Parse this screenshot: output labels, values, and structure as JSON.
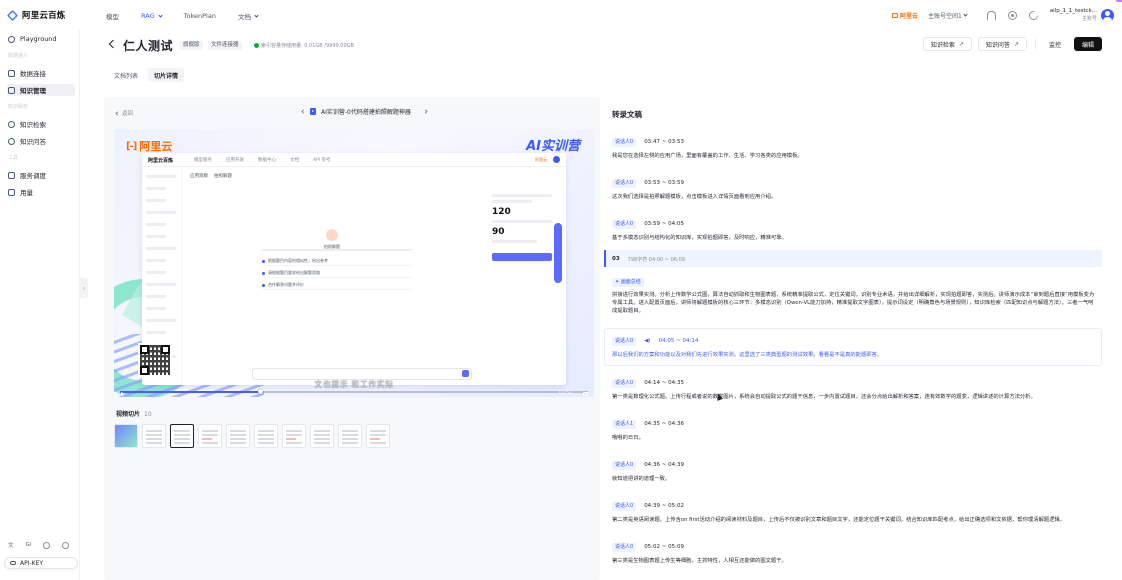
{
  "app": {
    "logo_text": "阿里云百炼",
    "nav": [
      {
        "label": "模型",
        "dropdown": false,
        "active": false
      },
      {
        "label": "RAG",
        "dropdown": true,
        "active": true
      },
      {
        "label": "TokenPlan",
        "dropdown": false,
        "active": false
      },
      {
        "label": "文档",
        "dropdown": true,
        "active": false
      }
    ],
    "brand_label": "阿里云",
    "workspace_label": "主账号空间1",
    "user_name": "ailp_1_1_testck...",
    "user_role": "主账号",
    "corner_tag": "",
    "accent_color": "#3d5afe"
  },
  "sidebar": {
    "items": [
      {
        "label": "Playground",
        "icon": "chat-icon",
        "active": false
      },
      {
        "label": "数据连接",
        "icon": "link-icon",
        "active": false
      },
      {
        "label": "知识管理",
        "icon": "book-icon",
        "active": true
      },
      {
        "label": "知识检索",
        "icon": "search-icon",
        "active": false
      },
      {
        "label": "知识问答",
        "icon": "qa-icon",
        "active": false
      },
      {
        "label": "服务调度",
        "icon": "service-icon",
        "active": false
      },
      {
        "label": "用量",
        "icon": "chart-icon",
        "active": false
      }
    ],
    "groups": [
      "数据接入",
      "知识服务",
      "工具"
    ],
    "bottom_icons": [
      "文",
      "Gi"
    ],
    "api_key_label": "API-KEY"
  },
  "header": {
    "title": "仁人测试",
    "tag1": "旗舰版",
    "tag2": "文件连接器",
    "index_status": "索引容量存储用量: 0.01GB /9999.00GB",
    "buttons": {
      "retrieve": "知识检索",
      "qa": "知识问答",
      "monitor": "监控",
      "edit": "编辑"
    }
  },
  "tabs": [
    {
      "label": "文档列表",
      "active": false
    },
    {
      "label": "切片详情",
      "active": true
    }
  ],
  "video_panel": {
    "back_label": "返回",
    "file_name": "AI实训营-0代码搭建拍照解题神器",
    "video_logo": "阿里云",
    "video_badge": "AI实训营",
    "video_badge_sub": "",
    "inner_logo": "阿里云百炼",
    "inner_nav": [
      "模型服务",
      "应用开发",
      "数据中心",
      "文档",
      "API 参考"
    ],
    "inner_crumb": [
      "应用观察",
      "拍照解题"
    ],
    "inner_center_caption": "拍照解题",
    "inner_options": [
      "根据题目内容的相似性，给出参考",
      "请根据题目要求给出解题思路",
      "合作解答问题并评价"
    ],
    "inner_panel_num1": "120",
    "inner_panel_num2": "90",
    "subtitle": "文也提示 和工作实际",
    "time": "03:53",
    "progress": 0.3,
    "clips_title": "视频切片",
    "clips_count": "10"
  },
  "transcript": {
    "title": "转录文稿",
    "segments": [
      {
        "speaker": "说话人0",
        "time": "03:47 ~ 03:53",
        "text": "我是您在选择左侧的应用广场，里面有覆盖的工作、生活、学习各类的应用模板。"
      },
      {
        "speaker": "说话人0",
        "time": "03:53 ~ 03:59",
        "text": "这次我们选择是拍照解题模板，点击模板进入详情页面看到应用介绍。"
      },
      {
        "speaker": "说话人0",
        "time": "03:59 ~ 04:05",
        "text": "基于多模态识别与结构化的知识库，实现拍题即答，及时响应，精准可靠。"
      },
      {
        "num": "03",
        "meta": "798字符  04:00 ~ 06:09",
        "section_tag": "画面总结",
        "text": "拼接进行效果实测。分析上传数学公式图，算法自动抓取和生物图表题，系统精准提取公式，定位关键词，识别专业术语，并给出详细解析，实现拍题即答，实测后。讲师演示成本“拿到题后直接”用模板变为专属工具。进入配置页面后，讲师将解题模板的核心三环节：多模态识别（Qwen-VL能力加持，精准提取文字图表），提示词设定（明确角色与场景规则），知识库检索（匹配知识点与解题方法）。三者一气呵成提取题目。"
      },
      {
        "speaker": "说话人0",
        "time": "04:05 ~ 04:14",
        "text": "那以后我们的方案和功能以及对我们先进行效果实测。这里选了三类典型题的测试效果。看看是不是真的能题即答。",
        "blue": true
      },
      {
        "speaker": "说话人0",
        "time": "04:14 ~ 04:35",
        "text": "第一类是数理化公式题。上传行程或者说的数学图片，系统会自动提取公式的题干信息，一步内置试题目，还会分点给出解析和答案，连有效数学的题变，逻辑讲述的计算方法分析。"
      },
      {
        "speaker": "说话人1",
        "time": "04:35 ~ 04:36",
        "text": "哦哦的日日。"
      },
      {
        "speaker": "说话人0",
        "time": "04:36 ~ 04:39",
        "text": "就知道把讲的道理一致。"
      },
      {
        "speaker": "说话人0",
        "time": "04:39 ~ 05:02",
        "text": "第二类是英语阅读题。上传含on first活动介绍的阅读材料及题目，上传后不仅被识别文章和题目文字，还能定位题干关键词，结合知识库匹配考点，给出正确选项和文依据，帮你理清解题逻辑。"
      },
      {
        "speaker": "说话人0",
        "time": "05:02 ~ 05:09",
        "text": "第三类是生物图表题上传生等细胞，主抓特性，人相互还能做的图文题干。"
      }
    ]
  }
}
